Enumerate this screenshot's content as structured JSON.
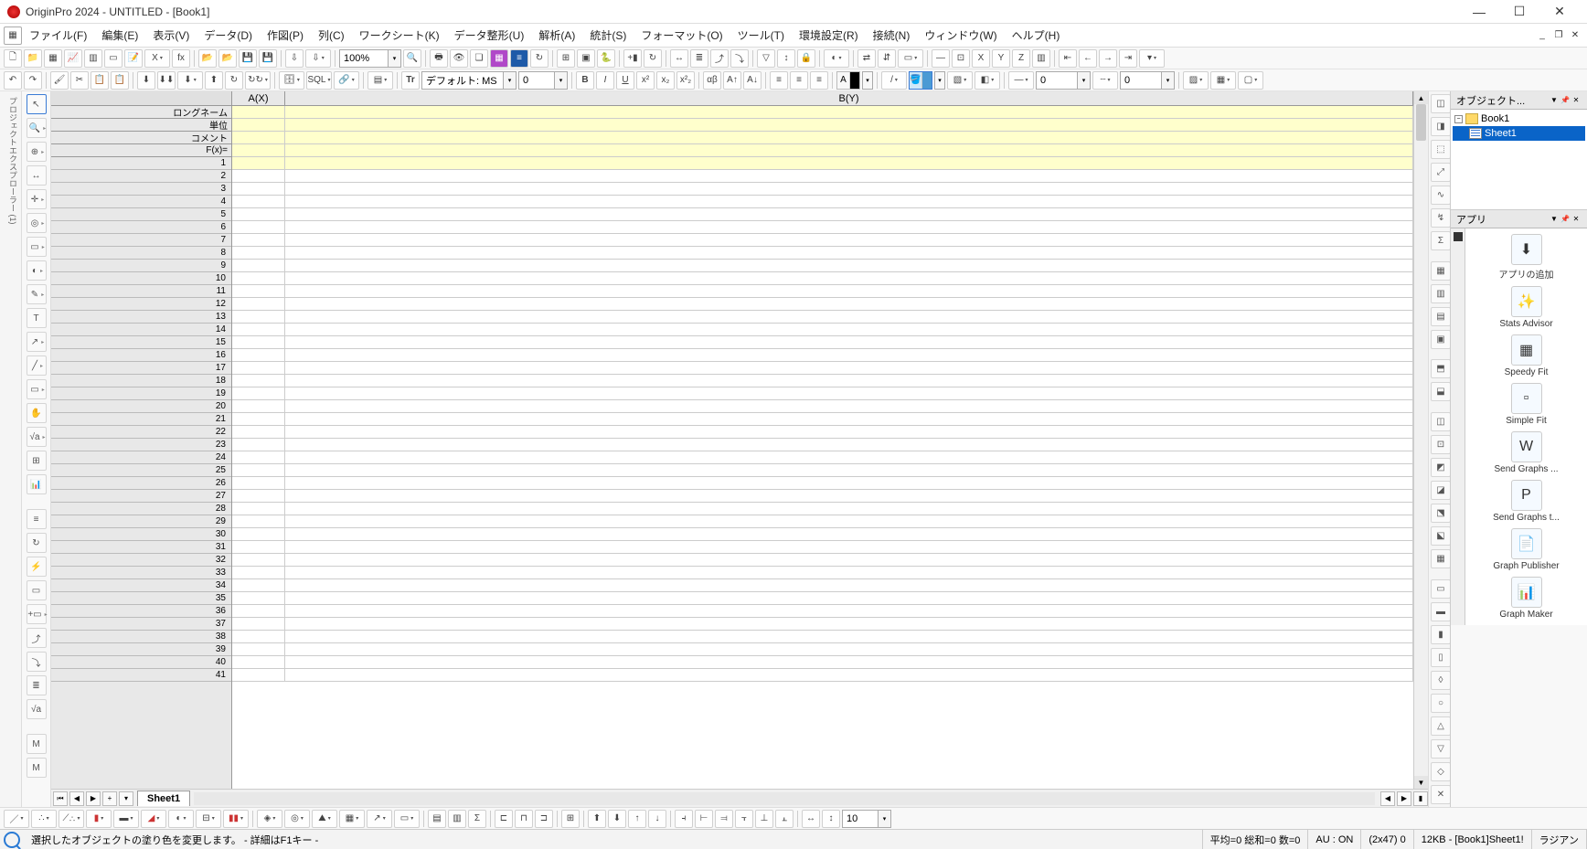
{
  "title": "OriginPro 2024 - UNTITLED - [Book1]",
  "menu": [
    "ファイル(F)",
    "編集(E)",
    "表示(V)",
    "データ(D)",
    "作図(P)",
    "列(C)",
    "ワークシート(K)",
    "データ整形(U)",
    "解析(A)",
    "統計(S)",
    "フォーマット(O)",
    "ツール(T)",
    "環境設定(R)",
    "接続(N)",
    "ウィンドウ(W)",
    "ヘルプ(H)"
  ],
  "zoom": "100%",
  "font_label": "デフォルト: MS PG",
  "font_size": "0",
  "num1": "0",
  "num2": "0",
  "colHeaders": {
    "a": "A(X)",
    "b": "B(Y)"
  },
  "rowLabels": [
    "ロングネーム",
    "単位",
    "コメント",
    "F(x)="
  ],
  "sheetTab": "Sheet1",
  "objectPanel": "オブジェクト...",
  "appsPanel": "アプリ",
  "tree": {
    "book": "Book1",
    "sheet": "Sheet1"
  },
  "apps": [
    {
      "label": "アプリの追加",
      "icon": "⬇"
    },
    {
      "label": "Stats Advisor",
      "icon": "✨"
    },
    {
      "label": "Speedy Fit",
      "icon": "▦"
    },
    {
      "label": "Simple Fit",
      "icon": "▫"
    },
    {
      "label": "Send Graphs ...",
      "icon": "W"
    },
    {
      "label": "Send Graphs t...",
      "icon": "P"
    },
    {
      "label": "Graph Publisher",
      "icon": "📄"
    },
    {
      "label": "Graph Maker",
      "icon": "📊"
    }
  ],
  "status": {
    "hint": "選択したオブジェクトの塗り色を変更します。 - 詳細はF1キー -",
    "stats": "平均=0 総和=0 数=0",
    "au": "AU : ON",
    "sel": "(2x47) 0",
    "size": "12KB - [Book1]Sheet1!",
    "mode": "ラジアン"
  },
  "bottom_num": "10"
}
